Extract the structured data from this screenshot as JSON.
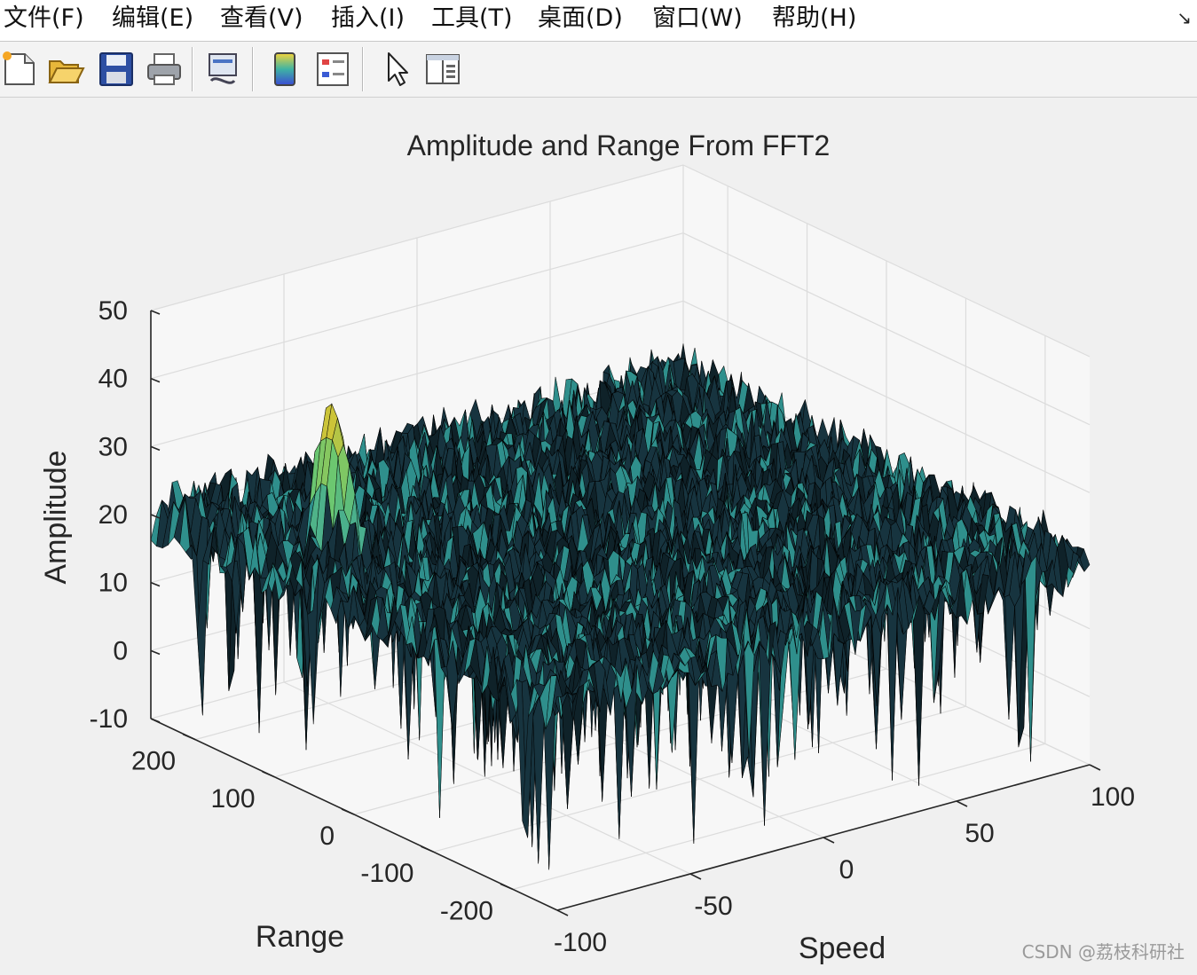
{
  "menu": [
    "文件(F)",
    "编辑(E)",
    "查看(V)",
    "插入(I)",
    "工具(T)",
    "桌面(D)",
    "窗口(W)",
    "帮助(H)"
  ],
  "dock_icon": "undock-arrow-icon",
  "toolbar": {
    "buttons": [
      "new-figure-icon",
      "open-file-icon",
      "save-icon",
      "print-icon",
      "link-plot-icon",
      "colorbar-icon",
      "legend-icon",
      "edit-plot-arrow-icon",
      "property-inspector-icon"
    ]
  },
  "watermark": "CSDN @荔枝科研社",
  "colors": {
    "surface_low": "#1b3a48",
    "surface_mid": "#3fb3a4",
    "surface_high": "#f2d630",
    "mesh": "#000000"
  },
  "chart_data": {
    "type": "surface",
    "title": "Amplitude and Range From FFT2",
    "xlabel": "Speed",
    "ylabel": "Range",
    "zlabel": "Amplitude",
    "xlim": [
      -100,
      100
    ],
    "ylim": [
      -256,
      256
    ],
    "zlim": [
      -10,
      50
    ],
    "xticks": [
      "-100",
      "-50",
      "0",
      "50",
      "100"
    ],
    "yticks": [
      "-200",
      "-100",
      "0",
      "100",
      "200"
    ],
    "zticks": [
      "-10",
      "0",
      "10",
      "20",
      "30",
      "40",
      "50"
    ],
    "grid": true,
    "noise_floor_level": 20,
    "peak": {
      "speed": -80,
      "range": 96,
      "amplitude": 43
    }
  }
}
